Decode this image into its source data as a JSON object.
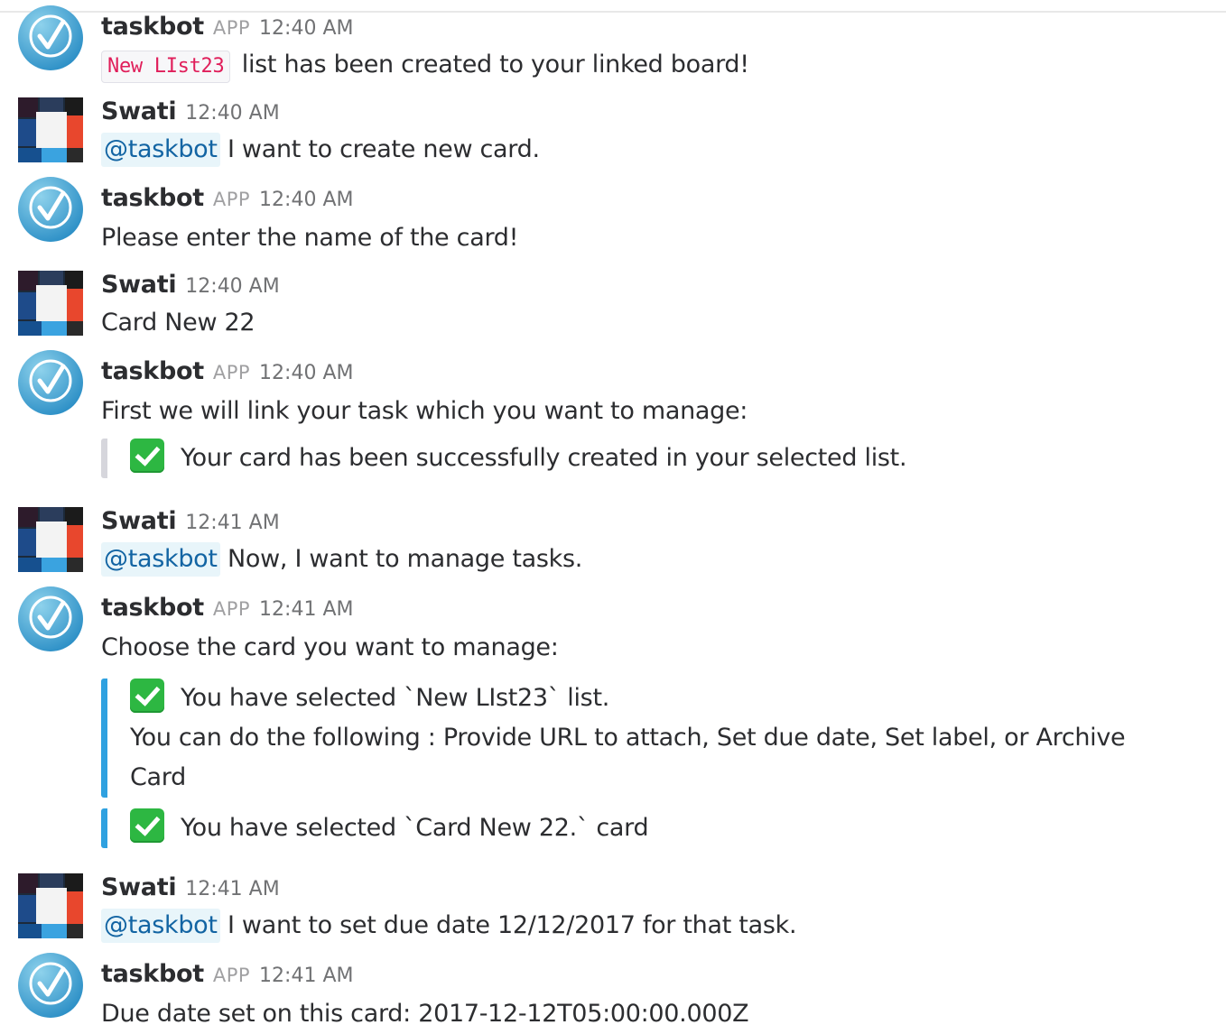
{
  "colors": {
    "mention_text": "#1264a3",
    "mention_bg": "#e8f5fa",
    "code_text": "#e01e5a",
    "attachment_bar_gray": "#d6d6dc",
    "attachment_bar_blue": "#2fa1e0",
    "check_green": "#2db742"
  },
  "messages": [
    {
      "author": "taskbot",
      "badge": "APP",
      "time": "12:40 AM",
      "avatar": "taskbot-check-icon",
      "code": "New LIst23",
      "text": "list has been created to your linked board!"
    },
    {
      "author": "Swati",
      "time": "12:40 AM",
      "avatar": "trello-style-avatar-icon",
      "mention": "@taskbot",
      "text": "I want to create new card."
    },
    {
      "author": "taskbot",
      "badge": "APP",
      "time": "12:40 AM",
      "avatar": "taskbot-check-icon",
      "text": "Please enter the name of the card!"
    },
    {
      "author": "Swati",
      "time": "12:40 AM",
      "avatar": "trello-style-avatar-icon",
      "text": "Card New 22"
    },
    {
      "author": "taskbot",
      "badge": "APP",
      "time": "12:40 AM",
      "avatar": "taskbot-check-icon",
      "text": "First we will link your task which you want to manage:",
      "attachment": "Your card has been successfully created in your selected list."
    },
    {
      "author": "Swati",
      "time": "12:41 AM",
      "avatar": "trello-style-avatar-icon",
      "mention": "@taskbot",
      "text": "Now, I want to manage tasks."
    },
    {
      "author": "taskbot",
      "badge": "APP",
      "time": "12:41 AM",
      "avatar": "taskbot-check-icon",
      "text": "Choose the card you want to manage:",
      "attachment1_line1": "You have selected `New LIst23` list.",
      "attachment1_line2": "You can do the following : Provide URL to attach, Set due date, Set label, or Archive",
      "attachment1_line3": "Card",
      "attachment2": "You have selected `Card New 22.` card"
    },
    {
      "author": "Swati",
      "time": "12:41 AM",
      "avatar": "trello-style-avatar-icon",
      "mention": "@taskbot",
      "text": "I want to set due date 12/12/2017 for that task."
    },
    {
      "author": "taskbot",
      "badge": "APP",
      "time": "12:41 AM",
      "avatar": "taskbot-check-icon",
      "text": "Due date set on this card: 2017-12-12T05:00:00.000Z"
    }
  ]
}
